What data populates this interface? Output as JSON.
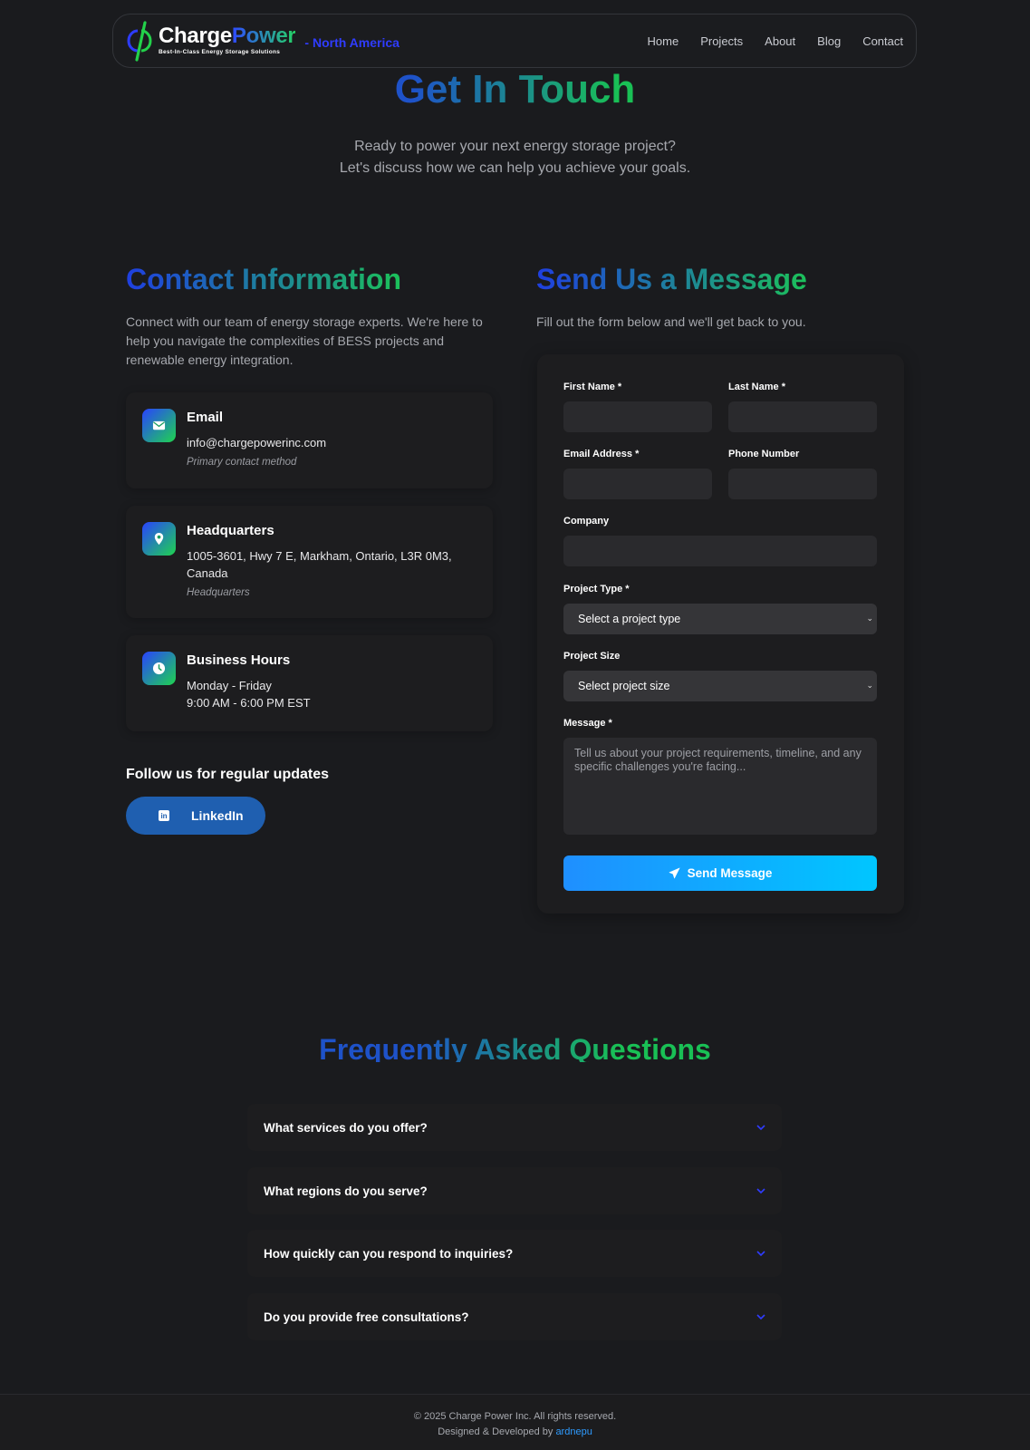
{
  "brand": {
    "name_part1": "Charge",
    "name_part2": "Power",
    "tagline": "Best-In-Class Energy Storage Solutions",
    "region": "- North America",
    "accent_colors": [
      "#2f3cff",
      "#25d366"
    ]
  },
  "nav": {
    "links": [
      {
        "label": "Home"
      },
      {
        "label": "Projects"
      },
      {
        "label": "About"
      },
      {
        "label": "Blog"
      },
      {
        "label": "Contact"
      }
    ]
  },
  "hero": {
    "title": "Get In Touch",
    "subtitle_line1": "Ready to power your next energy storage project?",
    "subtitle_line2": "Let's discuss how we can help you achieve your goals."
  },
  "contact_info": {
    "title": "Contact Information",
    "description": "Connect with our team of energy storage experts. We're here to help you navigate the complexities of BESS projects and renewable energy integration.",
    "cards": [
      {
        "icon": "envelope-icon",
        "title": "Email",
        "line1": "info@chargepowerinc.com",
        "note": "Primary contact method"
      },
      {
        "icon": "map-pin-icon",
        "title": "Headquarters",
        "line1": "1005-3601, Hwy 7 E, Markham, Ontario, L3R 0M3, Canada",
        "note": "Headquarters"
      },
      {
        "icon": "clock-icon",
        "title": "Business Hours",
        "line1": "Monday - Friday",
        "line2": "9:00 AM - 6:00 PM EST"
      }
    ],
    "follow_label": "Follow us for regular updates",
    "linkedin_label": "LinkedIn"
  },
  "form": {
    "title": "Send Us a Message",
    "description": "Fill out the form below and we'll get back to you.",
    "first_name_label": "First Name *",
    "last_name_label": "Last Name *",
    "email_label": "Email Address *",
    "phone_label": "Phone Number",
    "company_label": "Company",
    "project_type_label": "Project Type *",
    "project_type_value": "Select a project type",
    "project_size_label": "Project Size",
    "project_size_value": "Select project size",
    "message_label": "Message *",
    "message_placeholder": "Tell us about your project requirements, timeline, and any specific challenges you're facing...",
    "submit_label": "Send Message"
  },
  "faq": {
    "title": "Frequently Asked Questions",
    "items": [
      {
        "question": "What services do you offer?"
      },
      {
        "question": "What regions do you serve?"
      },
      {
        "question": "How quickly can you respond to inquiries?"
      },
      {
        "question": "Do you provide free consultations?"
      }
    ]
  },
  "footer": {
    "copyright": "© 2025 Charge Power Inc. All rights reserved.",
    "credit_prefix": "Designed & Developed by ",
    "credit_name": "ardnepu"
  }
}
